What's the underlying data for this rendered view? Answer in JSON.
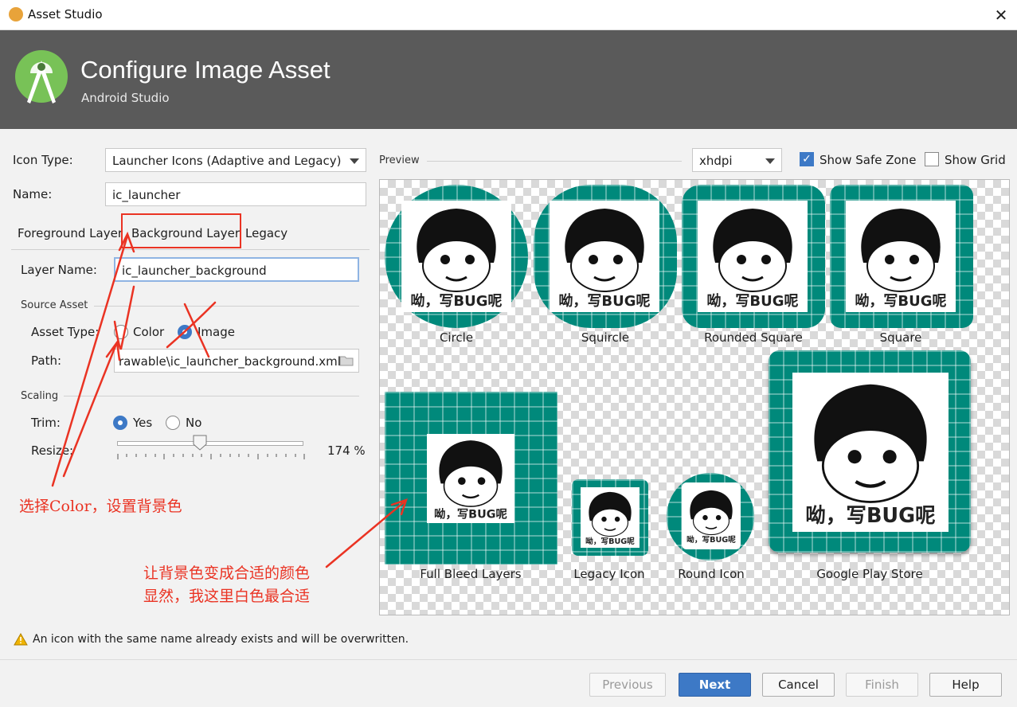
{
  "window": {
    "title": "Asset Studio",
    "close_glyph": "✕"
  },
  "header": {
    "title": "Configure Image Asset",
    "subtitle": "Android Studio"
  },
  "form": {
    "icon_type_label": "Icon Type:",
    "icon_type_value": "Launcher Icons (Adaptive and Legacy)",
    "name_label": "Name:",
    "name_value": "ic_launcher",
    "tabs": [
      "Foreground Layer",
      "Background Layer",
      "Legacy"
    ],
    "layer_name_label": "Layer Name:",
    "layer_name_value": "ic_launcher_background",
    "source_asset_label": "Source Asset",
    "asset_type_label": "Asset Type:",
    "asset_type_options": [
      "Color",
      "Image"
    ],
    "asset_type_selected": "Image",
    "path_label": "Path:",
    "path_value": "rawable\\ic_launcher_background.xml",
    "scaling_label": "Scaling",
    "trim_label": "Trim:",
    "trim_options": [
      "Yes",
      "No"
    ],
    "trim_selected": "Yes",
    "resize_label": "Resize:",
    "resize_value": "174 %",
    "resize_level": 174
  },
  "preview": {
    "label": "Preview",
    "density_value": "xhdpi",
    "show_safe_zone_label": "Show Safe Zone",
    "show_safe_zone_checked": true,
    "show_grid_label": "Show Grid",
    "show_grid_checked": false,
    "shapes": [
      "Circle",
      "Squircle",
      "Rounded Square",
      "Square",
      "Full Bleed Layers",
      "Legacy Icon",
      "Round Icon",
      "Google Play Store"
    ],
    "meme_caption": "呦，写BUG呢"
  },
  "annotations": {
    "note1": "选择Color，设置背景色",
    "note2_line1": "让背景色变成合适的颜色",
    "note2_line2": "显然，我这里白色最合适"
  },
  "warning": "An icon with the same name already exists and will be overwritten.",
  "buttons": {
    "previous": "Previous",
    "next": "Next",
    "cancel": "Cancel",
    "finish": "Finish",
    "help": "Help"
  },
  "colors": {
    "accent": "#3d79c6",
    "teal": "#00897b",
    "annotation": "#ea3323",
    "header_bg": "#5a5a5a"
  }
}
